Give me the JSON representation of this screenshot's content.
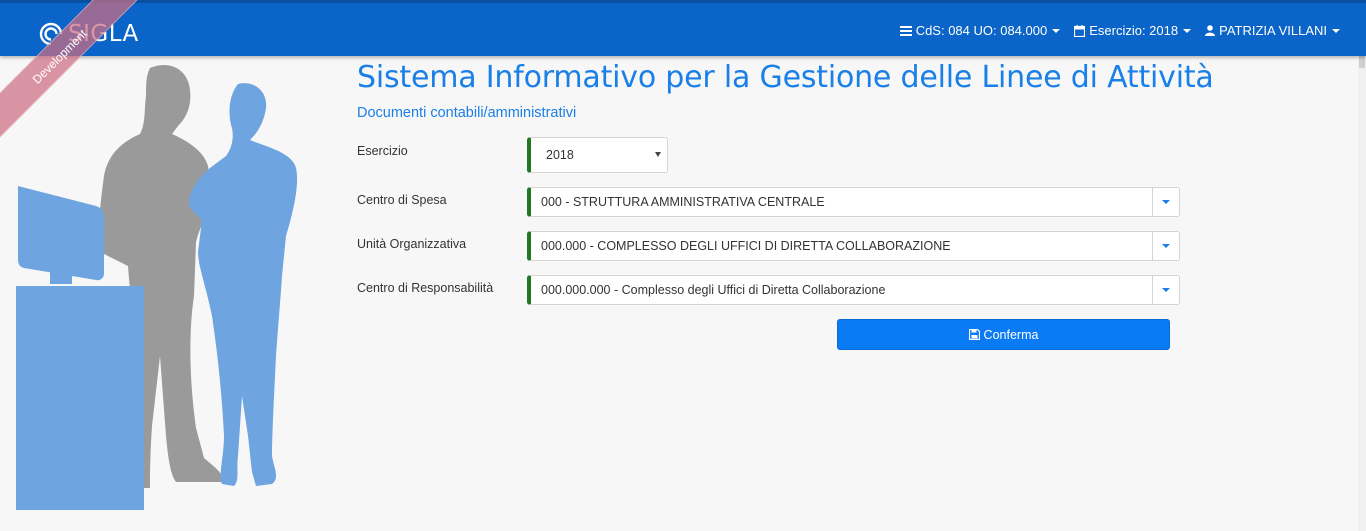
{
  "navbar": {
    "brand": "SIGLA",
    "cds": "CdS: 084 UO: 084.000",
    "esercizio": "Esercizio: 2018",
    "user": "PATRIZIA VILLANI"
  },
  "ribbon": "Development",
  "page": {
    "title": "Sistema Informativo per la Gestione delle Linee di Attività",
    "subtitle": "Documenti contabili/amministrativi"
  },
  "form": {
    "esercizio": {
      "label": "Esercizio",
      "value": "2018"
    },
    "centro_spesa": {
      "label": "Centro di Spesa",
      "value": "000 - STRUTTURA AMMINISTRATIVA CENTRALE"
    },
    "unita_organizzativa": {
      "label": "Unità Organizzativa",
      "value": "000.000 - COMPLESSO DEGLI UFFICI DI DIRETTA COLLABORAZIONE"
    },
    "centro_responsabilita": {
      "label": "Centro di Responsabilità",
      "value": "000.000.000 - Complesso degli Uffici di Diretta Collaborazione"
    },
    "confirm_label": "Conferma"
  },
  "colors": {
    "navbar": "#0b64c7",
    "accent": "#1a7fe6",
    "button": "#0b7af5",
    "required_marker": "#1f7a1f"
  },
  "icons": {
    "menu": "bars-icon",
    "calendar": "calendar-icon",
    "user": "user-icon",
    "save": "save-icon"
  }
}
